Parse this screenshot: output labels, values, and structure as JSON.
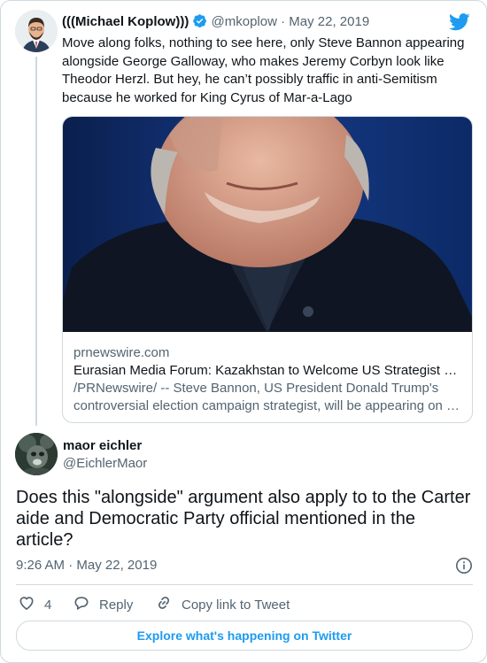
{
  "quoted_tweet": {
    "display_name": "(((Michael Koplow)))",
    "handle": "@mkoplow",
    "separator": "·",
    "date": "May 22, 2019",
    "text": "Move along folks, nothing to see here, only Steve Bannon appearing alongside George Galloway, who makes Jeremy Corbyn look like Theodor Herzl. But hey, he can’t possibly traffic in anti-Semitism because he worked for King Cyrus of Mar-a-Lago",
    "link_card": {
      "domain": "prnewswire.com",
      "title": "Eurasian Media Forum: Kazakhstan to Welcome US Strategist …",
      "description_line1": "/PRNewswire/ -- Steve Bannon, US President Donald Trump's",
      "description_line2": "controversial election campaign strategist, will be appearing on …"
    }
  },
  "tweet": {
    "display_name": "maor eichler",
    "handle": "@EichlerMaor",
    "text": "Does this \"alongside\" argument also apply to to the Carter aide and Democratic Party official mentioned in the article?",
    "time": "9:26 AM",
    "separator": "·",
    "date": "May 22, 2019"
  },
  "actions": {
    "like_count": "4",
    "reply_label": "Reply",
    "copy_link_label": "Copy link to Tweet"
  },
  "explore_label": "Explore what's happening on Twitter",
  "colors": {
    "twitter_blue": "#1d9bf0",
    "text_primary": "#0f1419",
    "text_secondary": "#536471",
    "border": "#cfd9de"
  },
  "icons": [
    "twitter-bird-icon",
    "verified-badge-icon",
    "info-icon",
    "heart-icon",
    "reply-icon",
    "link-icon"
  ]
}
